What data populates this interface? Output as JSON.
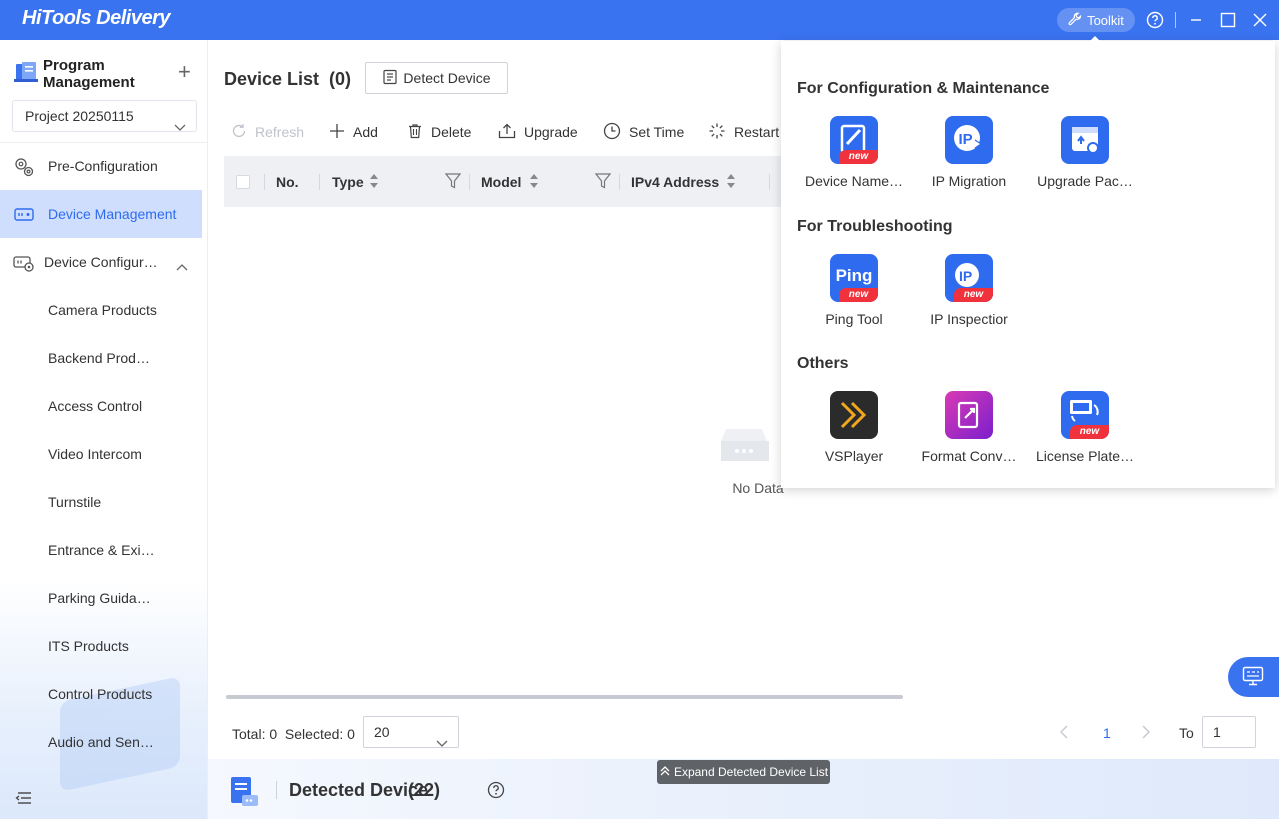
{
  "app": {
    "title": "HiTools Delivery"
  },
  "titlebar": {
    "toolkit_label": "Toolkit"
  },
  "sidebar": {
    "program_title": "Program Management",
    "project_select": "Project 20250115",
    "nav": [
      {
        "label": "Pre-Configuration",
        "icon": "gears-icon"
      },
      {
        "label": "Device Management",
        "icon": "device-icon"
      },
      {
        "label": "Device Configur…",
        "icon": "device-config-icon"
      }
    ],
    "sub_items": [
      "Camera Products",
      "Backend Prod…",
      "Access Control",
      "Video Intercom",
      "Turnstile",
      "Entrance & Exi…",
      "Parking Guida…",
      "ITS Products",
      "Control Products",
      "Audio and Sen…"
    ]
  },
  "main": {
    "title": "Device List",
    "count": "(0)",
    "detect_button": "Detect Device",
    "toolbar": {
      "refresh": "Refresh",
      "add": "Add",
      "delete": "Delete",
      "upgrade": "Upgrade",
      "set_time": "Set Time",
      "restart": "Restart"
    },
    "columns": [
      "No.",
      "Type",
      "Model",
      "IPv4 Address"
    ],
    "empty_text": "No Data",
    "footer": {
      "total": "Total: 0",
      "selected": "Selected: 0",
      "page_size": "20",
      "page": "1",
      "to_label": "To",
      "to_value": "1"
    },
    "detected": {
      "title": "Detected Device",
      "count": "(22)",
      "expand_label": "Expand Detected Device List"
    }
  },
  "toolkit": {
    "sections": [
      {
        "title": "For Configuration & Maintenance",
        "tools": [
          {
            "label": "Device Name…",
            "new": true,
            "icon": "device-name-icon"
          },
          {
            "label": "IP Migration",
            "new": false,
            "icon": "ip-migration-icon"
          },
          {
            "label": "Upgrade Pac…",
            "new": false,
            "icon": "upgrade-package-icon"
          }
        ]
      },
      {
        "title": "For Troubleshooting",
        "tools": [
          {
            "label": "Ping Tool",
            "new": true,
            "icon": "ping-icon"
          },
          {
            "label": "IP Inspectior",
            "new": true,
            "icon": "ip-inspection-icon"
          }
        ]
      },
      {
        "title": "Others",
        "tools": [
          {
            "label": "VSPlayer",
            "new": false,
            "icon": "vsplayer-icon"
          },
          {
            "label": "Format Conv…",
            "new": false,
            "icon": "format-convert-icon"
          },
          {
            "label": "License Plate…",
            "new": true,
            "icon": "license-plate-icon"
          }
        ]
      }
    ],
    "badge_text": "new",
    "ping_text": "Ping"
  },
  "colors": {
    "accent": "#3a73f0",
    "active_bg": "#cfdefc",
    "badge": "#f0323c"
  }
}
